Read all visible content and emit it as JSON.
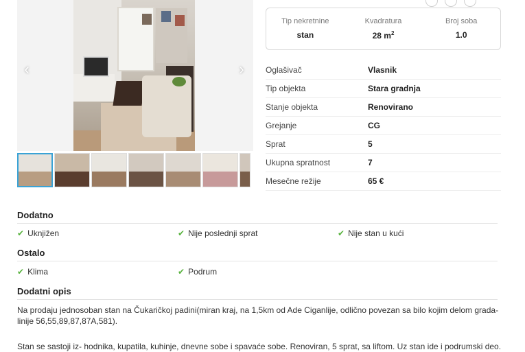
{
  "gallery": {
    "prev_icon": "chevron-left-icon",
    "next_icon": "chevron-right-icon",
    "prev_glyph": "‹",
    "next_glyph": "›",
    "thumbnail_count": 7,
    "active_thumbnail": 1
  },
  "stats": [
    {
      "label": "Tip nekretnine",
      "value": "stan"
    },
    {
      "label": "Kvadratura",
      "value": "28 m",
      "sup": "2"
    },
    {
      "label": "Broj soba",
      "value": "1.0"
    }
  ],
  "details": [
    {
      "label": "Oglašivač",
      "value": "Vlasnik"
    },
    {
      "label": "Tip objekta",
      "value": "Stara gradnja"
    },
    {
      "label": "Stanje objekta",
      "value": "Renovirano"
    },
    {
      "label": "Grejanje",
      "value": "CG"
    },
    {
      "label": "Sprat",
      "value": "5"
    },
    {
      "label": "Ukupna spratnost",
      "value": "7"
    },
    {
      "label": "Mesečne režije",
      "value": "65 €"
    }
  ],
  "sections": {
    "dodatno": {
      "title": "Dodatno",
      "items": [
        "Uknjižen",
        "Nije poslednji sprat",
        "Nije stan u kući"
      ]
    },
    "ostalo": {
      "title": "Ostalo",
      "items": [
        "Klima",
        "Podrum"
      ]
    },
    "opis": {
      "title": "Dodatni opis",
      "paragraph1": "Na prodaju jednosoban stan na Čukaričkoj padini(miran kraj, na 1,5km od Ade Ciganlije, odlično povezan sa bilo kojim delom grada- linije 56,55,89,87,87A,581).",
      "paragraph2": "Stan se sastoji iz- hodnika, kupatila, kuhinje, dnevne sobe i spavaće sobe. Renoviran, 5 sprat, sa liftom. Uz stan ide i podrumski deo."
    }
  },
  "colors": {
    "check": "#57b23d",
    "active_thumb_border": "#3aa3d6",
    "rule": "#e3e3e3"
  }
}
